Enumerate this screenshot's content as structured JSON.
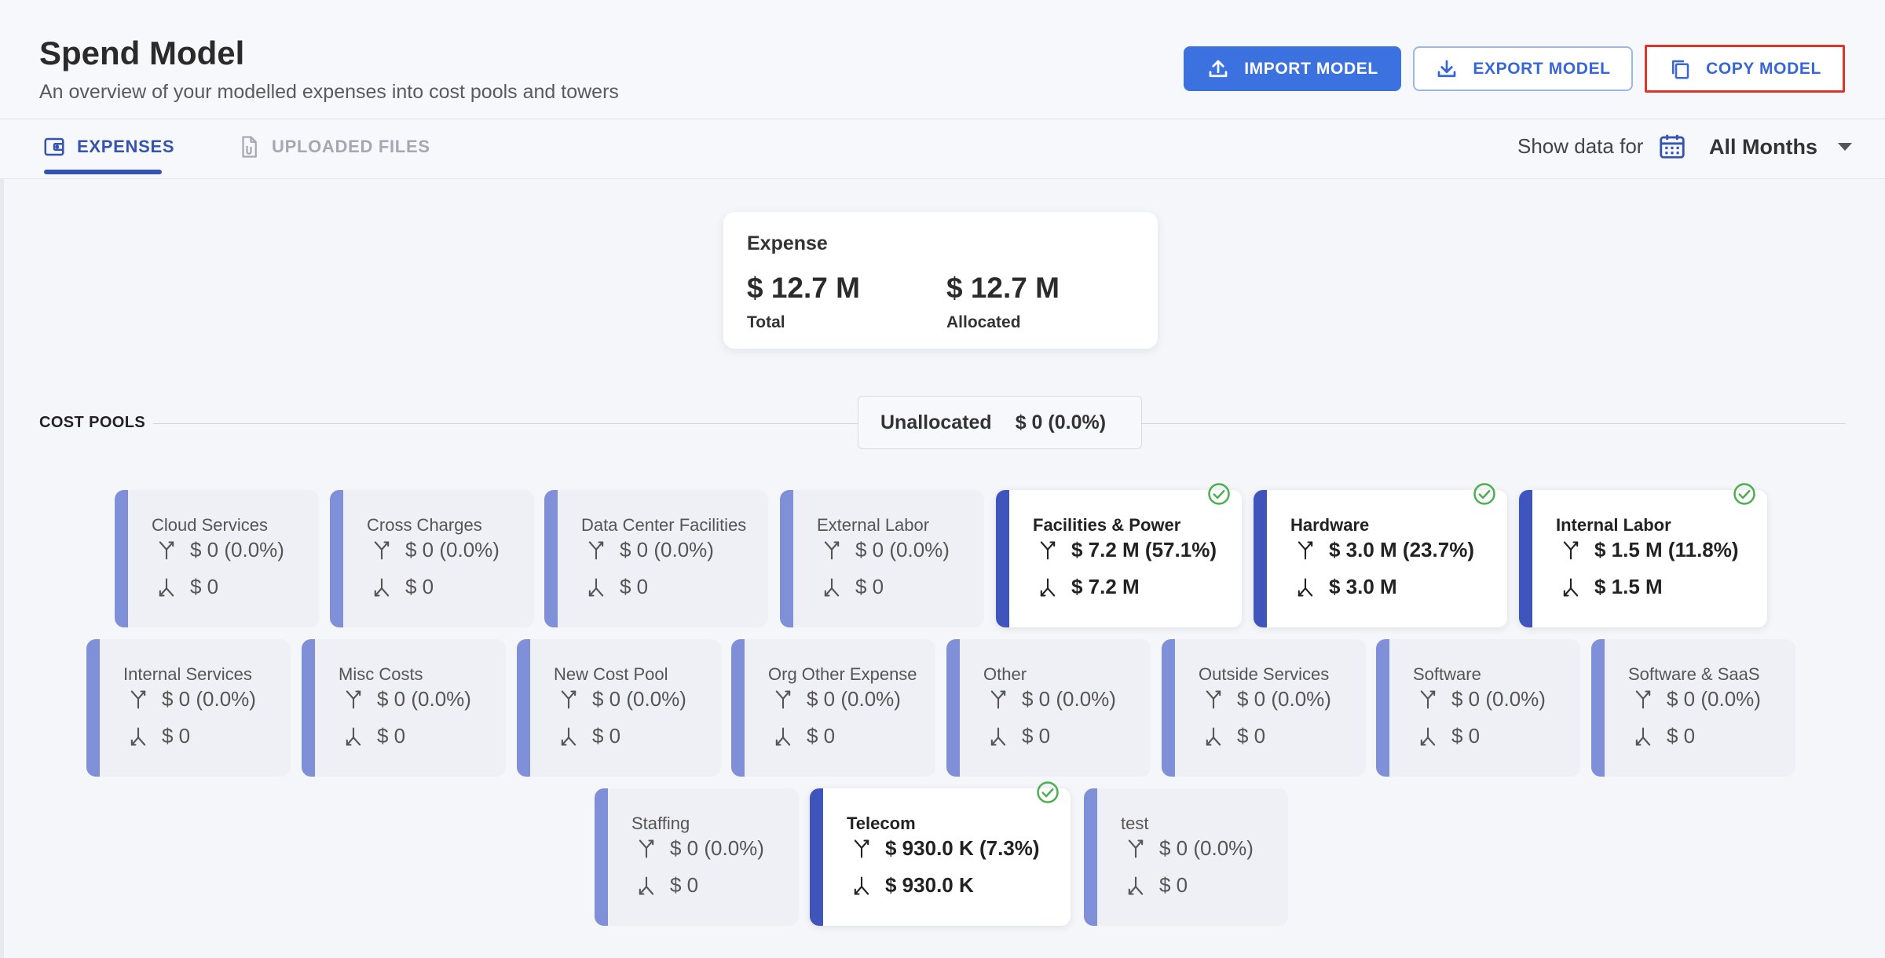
{
  "header": {
    "title": "Spend Model",
    "subtitle": "An overview of your modelled expenses into cost pools and towers",
    "import_label": "IMPORT MODEL",
    "export_label": "EXPORT MODEL",
    "copy_label": "COPY MODEL"
  },
  "tabs": [
    {
      "label": "EXPENSES",
      "active": true
    },
    {
      "label": "UPLOADED FILES",
      "active": false
    }
  ],
  "filter": {
    "label": "Show data for",
    "selected": "All Months"
  },
  "expense": {
    "title": "Expense",
    "total_value": "$ 12.7 M",
    "total_label": "Total",
    "allocated_value": "$ 12.7 M",
    "allocated_label": "Allocated"
  },
  "cost_pools_label": "COST POOLS",
  "unallocated": {
    "label": "Unallocated",
    "value": "$ 0 (0.0%)"
  },
  "pools": [
    {
      "name": "Cloud Services",
      "inflow": "$ 0 (0.0%)",
      "outflow": "$ 0",
      "active": false
    },
    {
      "name": "Cross Charges",
      "inflow": "$ 0 (0.0%)",
      "outflow": "$ 0",
      "active": false
    },
    {
      "name": "Data Center Facilities",
      "inflow": "$ 0 (0.0%)",
      "outflow": "$ 0",
      "active": false
    },
    {
      "name": "External Labor",
      "inflow": "$ 0 (0.0%)",
      "outflow": "$ 0",
      "active": false
    },
    {
      "name": "Facilities & Power",
      "inflow": "$ 7.2 M (57.1%)",
      "outflow": "$ 7.2 M",
      "active": true
    },
    {
      "name": "Hardware",
      "inflow": "$ 3.0 M (23.7%)",
      "outflow": "$ 3.0 M",
      "active": true
    },
    {
      "name": "Internal Labor",
      "inflow": "$ 1.5 M (11.8%)",
      "outflow": "$ 1.5 M",
      "active": true
    },
    {
      "name": "Internal Services",
      "inflow": "$ 0 (0.0%)",
      "outflow": "$ 0",
      "active": false
    },
    {
      "name": "Misc Costs",
      "inflow": "$ 0 (0.0%)",
      "outflow": "$ 0",
      "active": false
    },
    {
      "name": "New Cost Pool",
      "inflow": "$ 0 (0.0%)",
      "outflow": "$ 0",
      "active": false
    },
    {
      "name": "Org Other Expense",
      "inflow": "$ 0 (0.0%)",
      "outflow": "$ 0",
      "active": false
    },
    {
      "name": "Other",
      "inflow": "$ 0 (0.0%)",
      "outflow": "$ 0",
      "active": false
    },
    {
      "name": "Outside Services",
      "inflow": "$ 0 (0.0%)",
      "outflow": "$ 0",
      "active": false
    },
    {
      "name": "Software",
      "inflow": "$ 0 (0.0%)",
      "outflow": "$ 0",
      "active": false
    },
    {
      "name": "Software & SaaS",
      "inflow": "$ 0 (0.0%)",
      "outflow": "$ 0",
      "active": false
    },
    {
      "name": "Staffing",
      "inflow": "$ 0 (0.0%)",
      "outflow": "$ 0",
      "active": false
    },
    {
      "name": "Telecom",
      "inflow": "$ 930.0 K (7.3%)",
      "outflow": "$ 930.0 K",
      "active": true
    },
    {
      "name": "test",
      "inflow": "$ 0 (0.0%)",
      "outflow": "$ 0",
      "active": false
    }
  ],
  "colors": {
    "primary": "#3b72e0",
    "accent_dark": "#3f55bc",
    "accent_light": "#8090d8",
    "check_green": "#4caf50",
    "highlight_red": "#e0342a"
  }
}
